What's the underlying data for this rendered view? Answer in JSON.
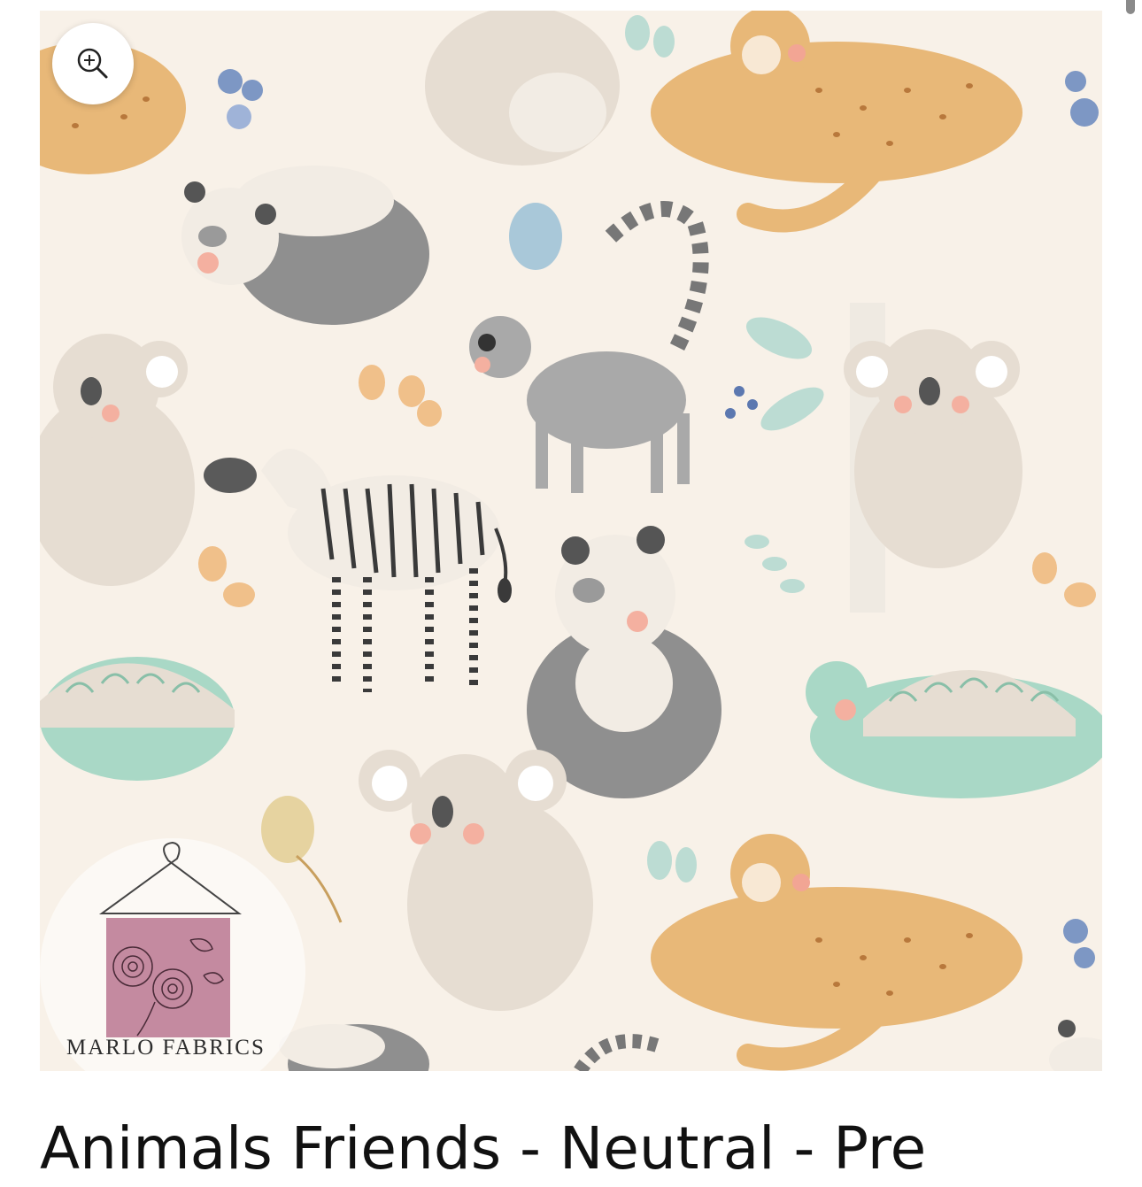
{
  "product": {
    "title": "Animals Friends - Neutral - Pre",
    "zoom_icon": "zoom-in-icon",
    "image_alt_subjects": [
      "cheetah",
      "koala",
      "panda",
      "lemur",
      "zebra",
      "tortoise",
      "flowers",
      "leaves"
    ]
  },
  "brand": {
    "logo_text": "MARLO FABRICS",
    "logo_icons": [
      "hanger-icon",
      "rose-swatch-icon"
    ],
    "swatch_color": "#c48aa0"
  },
  "colors": {
    "background": "#f8f1e8",
    "cheetah": "#e8b878",
    "koala": "#e6ddd2",
    "panda_dark": "#8f8f8f",
    "tortoise": "#a9d8c6",
    "flower_blue": "#7d97c4"
  }
}
